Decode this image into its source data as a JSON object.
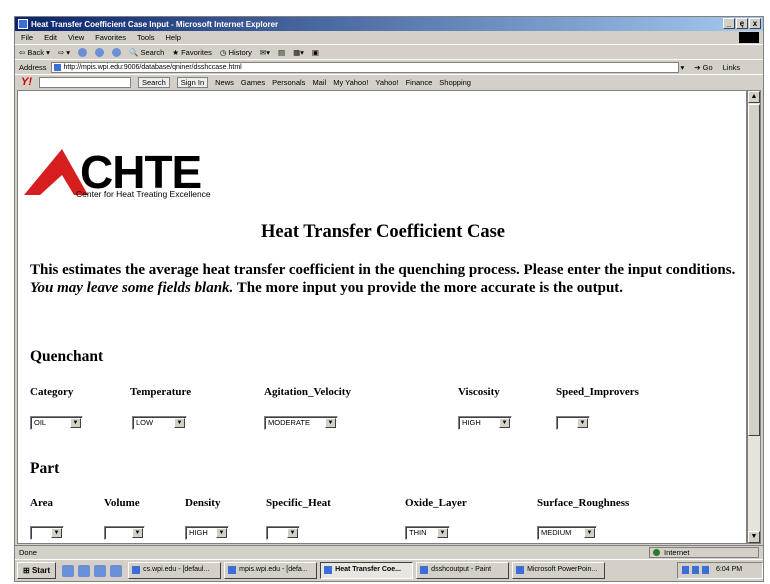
{
  "window": {
    "title": "Heat Transfer Coefficient Case Input - Microsoft Internet Explorer",
    "controls": [
      "_",
      "ę",
      "x"
    ]
  },
  "menu": [
    "File",
    "Edit",
    "View",
    "Favorites",
    "Tools",
    "Help"
  ],
  "toolbar": {
    "back": "Back",
    "search": "Search",
    "favorites": "Favorites",
    "history": "History"
  },
  "address": {
    "label": "Address",
    "url": "http://mpis.wpi.edu:9006/database/qniner/dsshccase.html",
    "go": "Go",
    "links": "Links"
  },
  "yahoo": {
    "logo": "Y!",
    "search_btn": "Search",
    "signin": "Sign In",
    "items": [
      "News",
      "Games",
      "Personals",
      "Mail",
      "My Yahoo!",
      "Yahoo!",
      "Finance",
      "Shopping"
    ]
  },
  "logo": {
    "text": "CHTE",
    "subtitle": "Center for Heat Treating Excellence"
  },
  "page": {
    "title": "Heat Transfer Coefficient Case",
    "intro_1": "This estimates the average heat transfer coefficient in the quenching process. Please enter the input conditions. ",
    "intro_italic": "You may leave some fields blank.",
    "intro_2": " The more input you provide the more accurate is the output."
  },
  "quenchant": {
    "heading": "Quenchant",
    "fields": [
      {
        "label": "Category",
        "value": "OIL"
      },
      {
        "label": "Temperature",
        "value": "LOW"
      },
      {
        "label": "Agitation_Velocity",
        "value": "MODERATE"
      },
      {
        "label": "Viscosity",
        "value": "HIGH"
      },
      {
        "label": "Speed_Improvers",
        "value": ""
      }
    ]
  },
  "part": {
    "heading": "Part",
    "fields": [
      {
        "label": "Area",
        "value": ""
      },
      {
        "label": "Volume",
        "value": ""
      },
      {
        "label": "Density",
        "value": "HIGH"
      },
      {
        "label": "Specific_Heat",
        "value": ""
      },
      {
        "label": "Oxide_Layer",
        "value": "THIN"
      },
      {
        "label": "Surface_Roughness",
        "value": "MEDIUM"
      }
    ]
  },
  "status": {
    "left": "Done",
    "zone": "Internet"
  },
  "taskbar": {
    "start": "Start",
    "tasks": [
      "cs.wpi.edu - [defaul...",
      "mpis.wpi.edu - [defa...",
      "Heat Transfer Coe...",
      "dsshcoutput - Paint",
      "Microsoft PowerPoin..."
    ],
    "clock": "6:04 PM"
  }
}
